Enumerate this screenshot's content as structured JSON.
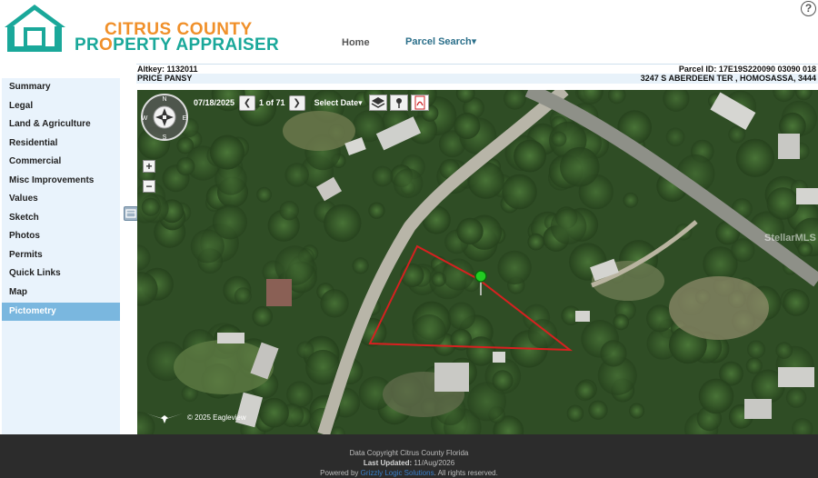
{
  "header": {
    "logo_line1": "CITRUS COUNTY",
    "logo_line2_a": "PR",
    "logo_line2_o": "O",
    "logo_line2_b": "PERTY APPRAISER",
    "nav_home": "Home",
    "nav_parcel_search": "Parcel Search▾",
    "help_icon": "?"
  },
  "info": {
    "altkey": "Altkey: 1132011",
    "parcel_id": "Parcel ID: 17E19S220090 03090 018",
    "owner": "PRICE PANSY",
    "address": "3247 S ABERDEEN TER , HOMOSASSA, 3444"
  },
  "sidebar": {
    "items": [
      {
        "label": "Summary"
      },
      {
        "label": "Legal"
      },
      {
        "label": "Land & Agriculture"
      },
      {
        "label": "Residential"
      },
      {
        "label": "Commercial"
      },
      {
        "label": "Misc Improvements"
      },
      {
        "label": "Values"
      },
      {
        "label": "Sketch"
      },
      {
        "label": "Photos"
      },
      {
        "label": "Permits"
      },
      {
        "label": "Quick Links"
      },
      {
        "label": "Map"
      },
      {
        "label": "Pictometry"
      }
    ],
    "active_index": 12
  },
  "map": {
    "date": "07/18/2025",
    "prev_icon": "chevron-left-icon",
    "next_icon": "chevron-right-icon",
    "prev_glyph": "❮",
    "next_glyph": "❯",
    "image_count": "1 of 71",
    "select_date_label": "Select Date▾",
    "zoom_in": "+",
    "zoom_out": "−",
    "watermark": "StellarMLS",
    "copyright": "© 2025 Eagleview",
    "compass_letters": [
      "N",
      "E",
      "S",
      "W"
    ]
  },
  "footer": {
    "line1": "Data Copyright Citrus County Florida",
    "last_updated_label": "Last Updated:",
    "last_updated_value": "11/Aug/2026",
    "powered_by": "Powered by",
    "powered_link": "Grizzly Logic Solutions",
    "rights": ". All rights reserved."
  },
  "colors": {
    "accent_orange": "#f0902a",
    "accent_teal": "#1aa89a",
    "sidebar_active": "#7ab7df",
    "parcel_outline": "#d82020"
  }
}
